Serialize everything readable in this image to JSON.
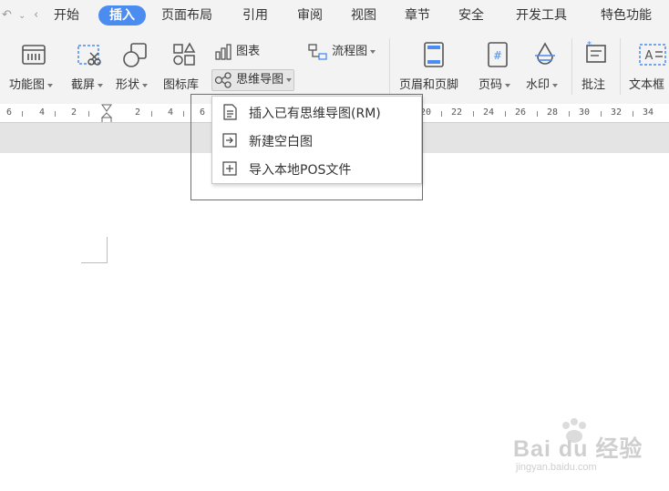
{
  "menubar": {
    "tabs": [
      {
        "label": "开始"
      },
      {
        "label": "插入",
        "active": true
      },
      {
        "label": "页面布局"
      },
      {
        "label": "引用"
      },
      {
        "label": "审阅"
      },
      {
        "label": "视图"
      },
      {
        "label": "章节"
      },
      {
        "label": "安全"
      },
      {
        "label": "开发工具"
      },
      {
        "label": "特色功能"
      }
    ],
    "accent_color": "#4a8cf0"
  },
  "ribbon": {
    "function_chart": "功能图",
    "screenshot": "截屏",
    "shapes": "形状",
    "icon_library": "图标库",
    "chart": "图表",
    "flowchart": "流程图",
    "mindmap": "思维导图",
    "header_footer": "页眉和页脚",
    "page_number": "页码",
    "watermark": "水印",
    "comment": "批注",
    "textbox": "文本框"
  },
  "ruler": {
    "labels": [
      "6",
      "4",
      "2",
      "2",
      "4",
      "6",
      "20",
      "22",
      "24",
      "26",
      "28",
      "30",
      "32",
      "34"
    ]
  },
  "dropdown": {
    "items": [
      {
        "label": "插入已有思维导图(RM)",
        "icon": "insert-file-icon"
      },
      {
        "label": "新建空白图",
        "icon": "new-blank-icon"
      },
      {
        "label": "导入本地POS文件",
        "icon": "import-plus-icon"
      }
    ],
    "highlight_color": "#e0403a"
  },
  "watermark": {
    "main": "Bai du 经验",
    "sub": "jingyan.baidu.com"
  }
}
